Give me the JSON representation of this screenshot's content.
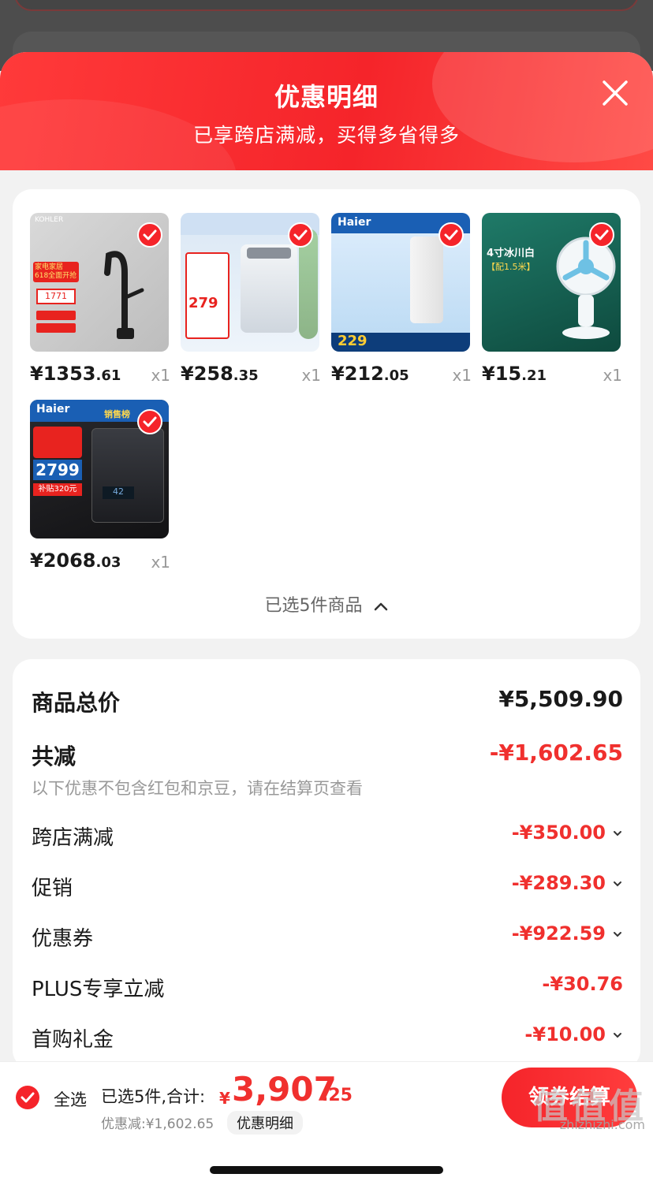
{
  "sheet": {
    "title": "优惠明细",
    "subtitle": "已享跨店满减，买得多省得多"
  },
  "goods": [
    {
      "price_int": "¥1353",
      "price_dec": ".61",
      "qty": "x1",
      "thumb": "faucet",
      "checked": true
    },
    {
      "price_int": "¥258",
      "price_dec": ".35",
      "qty": "x1",
      "thumb": "washer",
      "checked": true
    },
    {
      "price_int": "¥212",
      "price_dec": ".05",
      "qty": "x1",
      "thumb": "filter",
      "checked": true
    },
    {
      "price_int": "¥15",
      "price_dec": ".21",
      "qty": "x1",
      "thumb": "fan",
      "checked": true
    },
    {
      "price_int": "¥2068",
      "price_dec": ".03",
      "qty": "x1",
      "thumb": "water-heater",
      "checked": true
    }
  ],
  "selected_toggle": "已选5件商品",
  "summary": {
    "total_label": "商品总价",
    "total_value": "¥5,509.90",
    "discount_label": "共减",
    "discount_value": "-¥1,602.65",
    "note": "以下优惠不包含红包和京豆，请在结算页查看",
    "items": [
      {
        "label": "跨店满减",
        "value": "-¥350.00",
        "expandable": true
      },
      {
        "label": "促销",
        "value": "-¥289.30",
        "expandable": true
      },
      {
        "label": "优惠券",
        "value": "-¥922.59",
        "expandable": true
      },
      {
        "label": "PLUS专享立减",
        "value": "-¥30.76",
        "expandable": false
      },
      {
        "label": "首购礼金",
        "value": "-¥10.00",
        "expandable": true
      }
    ]
  },
  "bottom": {
    "select_all": "全选",
    "sum_label": "已选5件,合计:",
    "sum_yen": "¥",
    "sum_int": "3,907",
    "sum_dec": ".25",
    "discount_line": "优惠减:¥1,602.65",
    "detail_btn": "优惠明细",
    "checkout": "领券结算"
  },
  "thumb_texts": {
    "faucet_brand": "KOHLER",
    "faucet_tag": "家电家居 618全面开抢",
    "faucet_price": "1771",
    "washer_price": "279",
    "filter_brand": "Haier",
    "filter_price": "229",
    "fan_text1": "4寸冰川白",
    "fan_text2": "【配1.5米】",
    "heater_brand": "Haier",
    "heater_tag": "销售榜",
    "heater_price": "2799",
    "heater_sub": "补贴320元"
  },
  "watermark": "zhizhizhi.com",
  "watermark_logo": "值值值",
  "colors": {
    "accent": "#f5242a",
    "price_red": "#f0302e"
  }
}
